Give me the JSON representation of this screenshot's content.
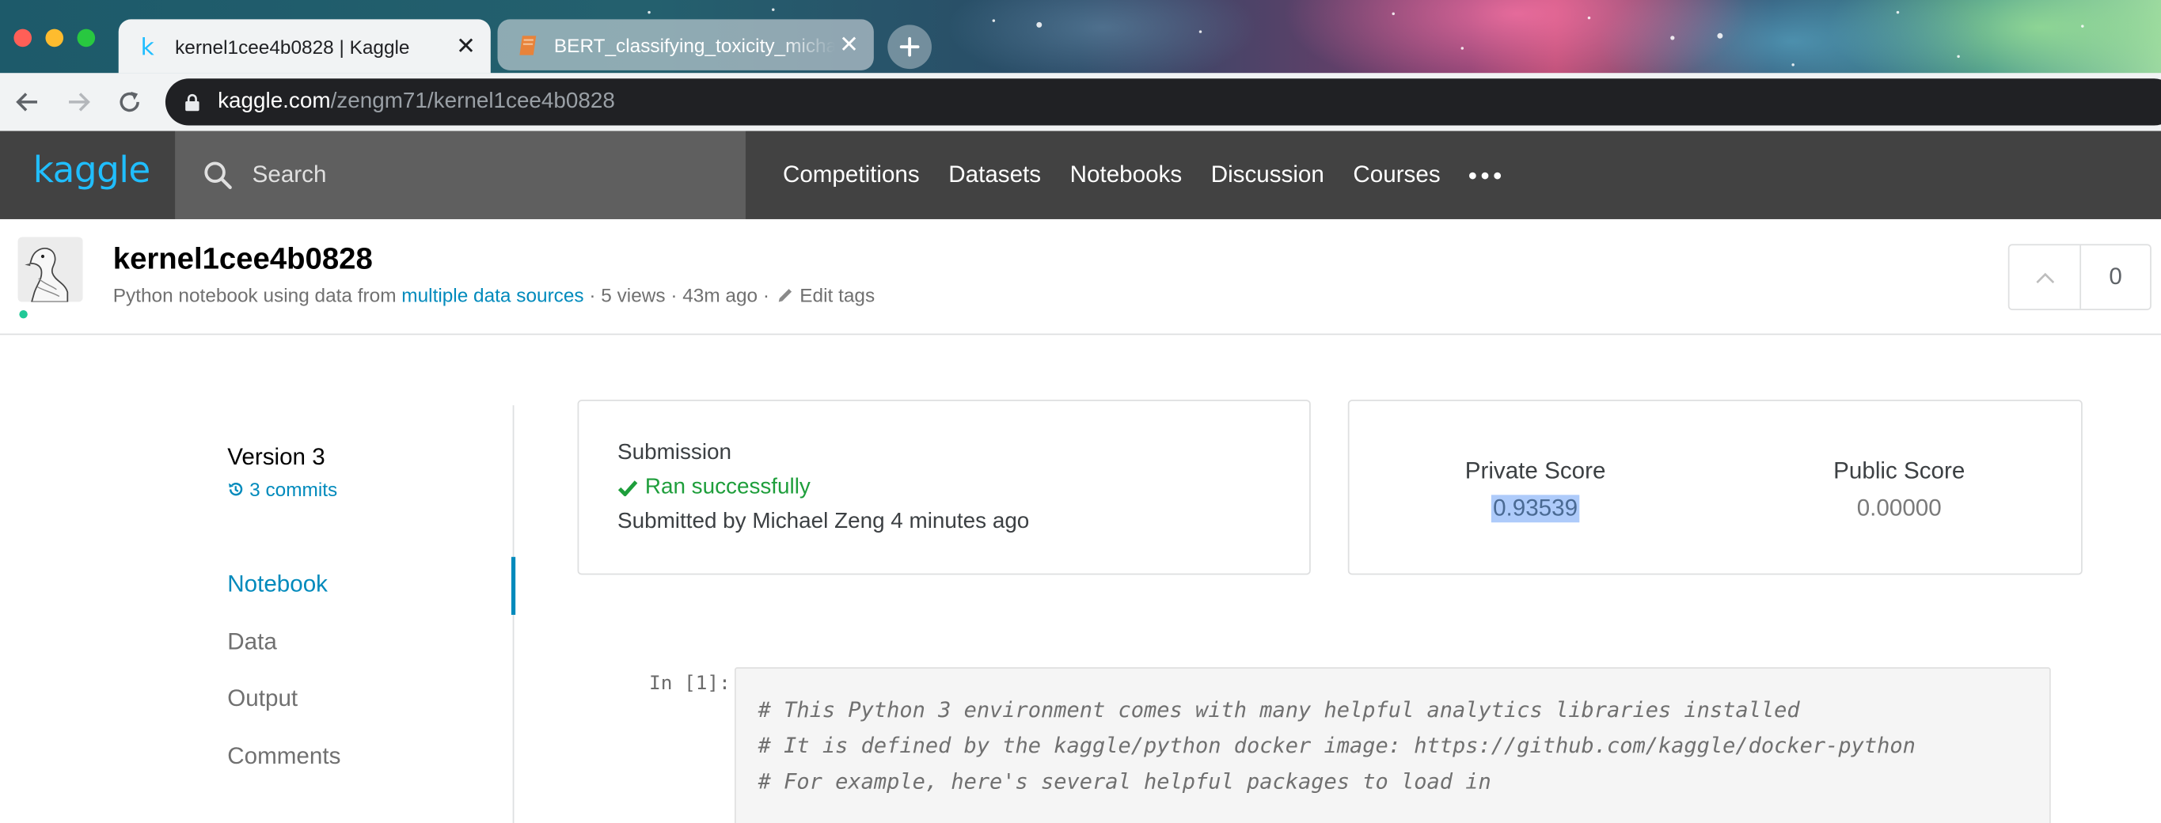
{
  "browser": {
    "tabs": [
      {
        "title": "kernel1cee4b0828 | Kaggle",
        "favicon": "kaggle-k-icon",
        "active": true
      },
      {
        "title": "BERT_classifying_toxicity_michae",
        "favicon": "notebook-icon",
        "active": false
      }
    ],
    "url_host": "kaggle.com",
    "url_path": "/zengm71/kernel1cee4b0828"
  },
  "kaggle_header": {
    "logo": "kaggle",
    "search_placeholder": "Search",
    "nav": [
      "Competitions",
      "Datasets",
      "Notebooks",
      "Discussion",
      "Courses"
    ]
  },
  "notebook": {
    "title": "kernel1cee4b0828",
    "meta_prefix": "Python notebook using data from",
    "meta_link": "multiple data sources",
    "meta_suffix": "· 5 views · 43m ago ·",
    "edit_tags": "Edit tags",
    "votes": "0"
  },
  "sidebar": {
    "version": "Version 3",
    "commits": "3 commits",
    "items": [
      "Notebook",
      "Data",
      "Output",
      "Comments"
    ],
    "active_item": "Notebook"
  },
  "submission": {
    "heading": "Submission",
    "status": "Ran successfully",
    "submitted_by": "Submitted by Michael Zeng 4 minutes ago"
  },
  "scores": {
    "private_label": "Private Score",
    "private_value": "0.93539",
    "public_label": "Public Score",
    "public_value": "0.00000"
  },
  "code_cell": {
    "prompt": "In [1]:",
    "lines": [
      "# This Python 3 environment comes with many helpful analytics libraries installed",
      "# It is defined by the kaggle/python docker image: https://github.com/kaggle/docker-python",
      "# For example, here's several helpful packages to load in"
    ]
  },
  "colors": {
    "kaggle_blue": "#20beff",
    "link_blue": "#008abc",
    "success_green": "#1e9e3b",
    "header_bg": "#424242",
    "selection": "#aecbfa"
  }
}
